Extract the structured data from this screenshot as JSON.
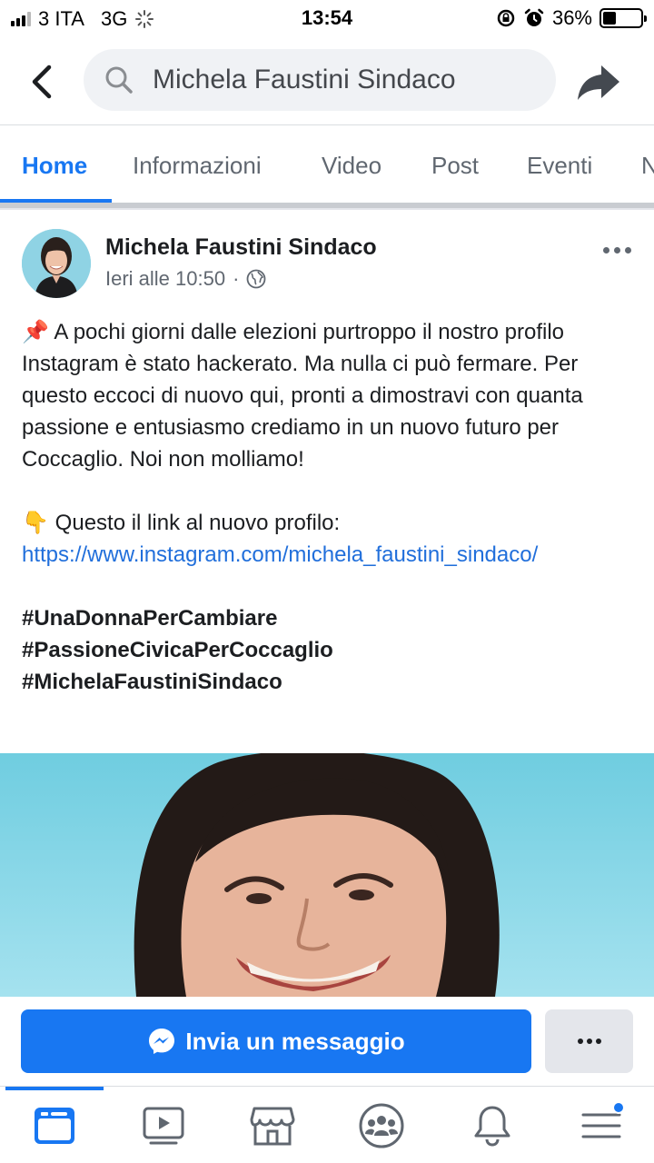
{
  "status_bar": {
    "carrier": "3 ITA",
    "network": "3G",
    "time": "13:54",
    "battery_percent": "36%",
    "battery_level": 0.36
  },
  "header": {
    "search_text": "Michela Faustini Sindaco"
  },
  "tabs": [
    {
      "label": "Home",
      "active": true
    },
    {
      "label": "Informazioni",
      "active": false
    },
    {
      "label": "Video",
      "active": false
    },
    {
      "label": "Post",
      "active": false
    },
    {
      "label": "Eventi",
      "active": false
    },
    {
      "label": "N",
      "active": false
    }
  ],
  "post": {
    "author": "Michela Faustini Sindaco",
    "timestamp": "Ieri alle 10:50",
    "meta_separator": "·",
    "pin_emoji": "📌",
    "paragraph1": "A pochi giorni dalle elezioni purtroppo il nostro profilo Instagram è  stato hackerato. Ma nulla ci può fermare. Per questo eccoci di nuovo qui, pronti a dimostravi con quanta passione e entusiasmo crediamo in un nuovo futuro per Coccaglio. Noi non molliamo!",
    "point_emoji": "👇",
    "link_intro": "Questo il link al nuovo profilo:",
    "link": "https://www.instagram.com/michela_faustini_sindaco/",
    "hashtags": [
      "#UnaDonnaPerCambiare",
      "#PassioneCivicaPerCoccaglio",
      "#MichelaFaustiniSindaco"
    ]
  },
  "actions": {
    "message_button": "Invia un messaggio"
  },
  "colors": {
    "brand_blue": "#1877f2",
    "link_blue": "#216fdb",
    "photo_background": "#8edbeb"
  },
  "bottom_nav": [
    {
      "icon": "news-feed-icon",
      "active": true
    },
    {
      "icon": "watch-video-icon",
      "active": false
    },
    {
      "icon": "marketplace-icon",
      "active": false
    },
    {
      "icon": "groups-icon",
      "active": false
    },
    {
      "icon": "notifications-bell-icon",
      "active": false
    },
    {
      "icon": "menu-icon",
      "active": false,
      "badge": true
    }
  ]
}
